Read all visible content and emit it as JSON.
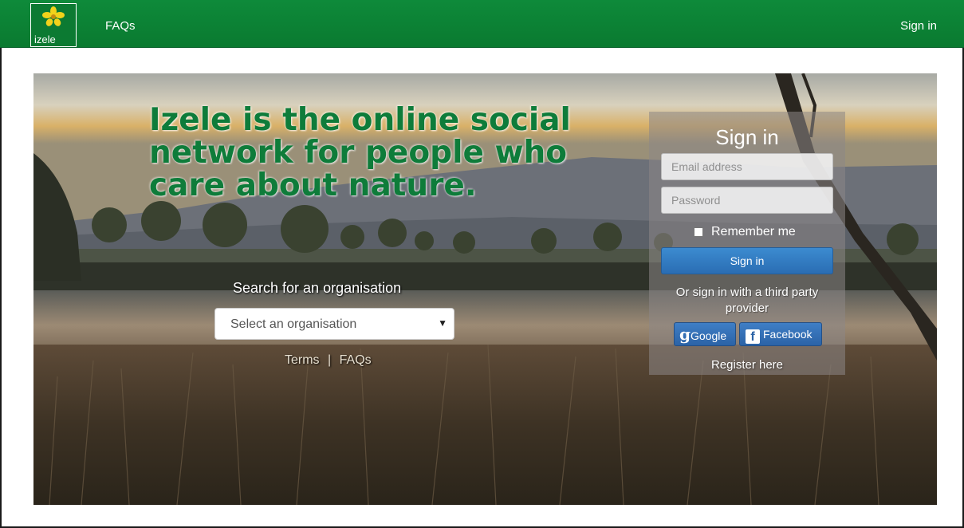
{
  "navbar": {
    "logo_text": "izele",
    "faqs": "FAQs",
    "sign_in": "Sign in",
    "color": "#0c7d35"
  },
  "hero": {
    "headline": "Izele is the online social network for people who care about nature.",
    "search_label": "Search for an organisation",
    "select_placeholder": "Select an organisation",
    "footer_terms": "Terms",
    "footer_separator": "|",
    "footer_faqs": "FAQs"
  },
  "signin_panel": {
    "title": "Sign in",
    "email_placeholder": "Email address",
    "password_placeholder": "Password",
    "remember_me": "Remember me",
    "submit": "Sign in",
    "third_party_text": "Or sign in with a third party provider",
    "google": "Google",
    "facebook": "Facebook",
    "register": "Register here"
  },
  "colors": {
    "accent_green": "#0e7c3a",
    "button_blue": "#2e6fb4"
  }
}
